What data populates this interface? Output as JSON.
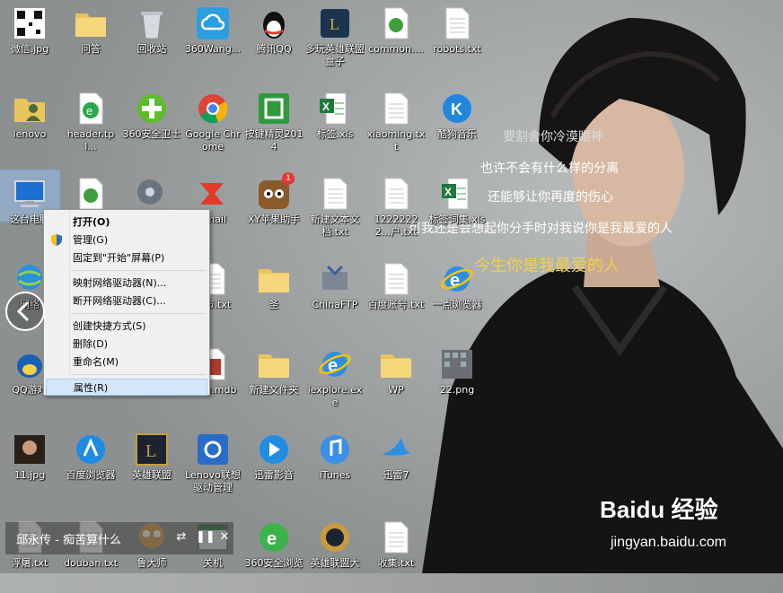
{
  "colors": {
    "accent_yellow": "#f3d04a",
    "selection": "#d5e6f8",
    "menu_bg": "#f0f0f0"
  },
  "lyrics": [
    "要割舍你冷漠眼神",
    "也许不会有什么样的分离",
    "还能够让你再度的伤心",
    "可我还是会想起你分手时对我说你是我最爱的人",
    "今生你是我最爱的人"
  ],
  "icons": [
    {
      "label": "微信.jpg",
      "icon": "qr-image-icon"
    },
    {
      "label": "问答",
      "icon": "folder-icon"
    },
    {
      "label": "回收站",
      "icon": "recycle-bin-icon"
    },
    {
      "label": "360Wang...",
      "icon": "cloud-icon"
    },
    {
      "label": "腾讯QQ",
      "icon": "qq-penguin-icon"
    },
    {
      "label": "多玩英雄联盟盒子",
      "icon": "game-box-icon"
    },
    {
      "label": "common....",
      "icon": "dreamweaver-file-icon"
    },
    {
      "label": "robots.txt",
      "icon": "text-file-icon"
    },
    {
      "label": "lenovo",
      "icon": "user-folder-icon"
    },
    {
      "label": "header.tpl...",
      "icon": "html-file-icon"
    },
    {
      "label": "360安全卫士",
      "icon": "360-guard-icon"
    },
    {
      "label": "Google Chrome",
      "icon": "chrome-icon"
    },
    {
      "label": "按键精灵2014",
      "icon": "macro-tool-icon"
    },
    {
      "label": "标签.xls",
      "icon": "excel-file-icon"
    },
    {
      "label": "xiaoming.txt",
      "icon": "text-file-icon"
    },
    {
      "label": "酷狗音乐",
      "icon": "kugou-icon"
    },
    {
      "label": "这台电脑",
      "icon": "computer-icon"
    },
    {
      "label": "",
      "icon": "dreamweaver-file-icon"
    },
    {
      "label": "",
      "icon": "settings-shield-icon"
    },
    {
      "label": "xmail",
      "icon": "foxmail-icon"
    },
    {
      "label": "XY苹果助手",
      "icon": "xy-helper-icon",
      "badge": "1"
    },
    {
      "label": "新建文本文档.txt",
      "icon": "text-file-icon"
    },
    {
      "label": "12222222...户.txt",
      "icon": "text-file-icon"
    },
    {
      "label": "标签词集.xls",
      "icon": "excel-file-icon"
    },
    {
      "label": "网络",
      "icon": "network-icon"
    },
    {
      "label": "",
      "icon": "folder-icon"
    },
    {
      "label": "省市.txt",
      "icon": "text-file-icon"
    },
    {
      "label": "圣",
      "icon": "folder-icon"
    },
    {
      "label": "ChinaFTP",
      "icon": "ftp-icon"
    },
    {
      "label": "百度账号.txt",
      "icon": "text-file-icon"
    },
    {
      "label": "一点浏览器",
      "icon": "ie-browser-icon"
    },
    {
      "label": "QQ游戏",
      "icon": "qq-game-icon"
    },
    {
      "label": "",
      "icon": "folder-icon"
    },
    {
      "label": "data.mdb",
      "icon": "database-file-icon"
    },
    {
      "label": "新建文件夹",
      "icon": "folder-icon"
    },
    {
      "label": "iexplore.exe",
      "icon": "ie-browser-icon"
    },
    {
      "label": "WP",
      "icon": "folder-icon"
    },
    {
      "label": "22.png",
      "icon": "image-file-icon"
    },
    {
      "label": "11.jpg",
      "icon": "photo-icon"
    },
    {
      "label": "百度浏览器",
      "icon": "baidu-browser-icon"
    },
    {
      "label": "英雄联盟",
      "icon": "lol-icon"
    },
    {
      "label": "Lenovo联想驱动管理",
      "icon": "lenovo-driver-icon"
    },
    {
      "label": "迅雷影音",
      "icon": "xunlei-player-icon"
    },
    {
      "label": "iTunes",
      "icon": "itunes-icon"
    },
    {
      "label": "迅雷7",
      "icon": "xunlei-bird-icon"
    },
    {
      "label": "浮屠.txt",
      "icon": "text-file-icon"
    },
    {
      "label": "douban.txt",
      "icon": "text-file-icon"
    },
    {
      "label": "鲁大师",
      "icon": "ludashi-icon"
    },
    {
      "label": "关机",
      "icon": "shutdown-icon"
    },
    {
      "label": "360安全浏览",
      "icon": "360-browser-icon"
    },
    {
      "label": "英雄联盟大",
      "icon": "lol-box-icon"
    },
    {
      "label": "收集.txt",
      "icon": "text-file-icon"
    }
  ],
  "context_menu": {
    "items": [
      {
        "label": "打开(O)",
        "bold": true
      },
      {
        "label": "管理(G)",
        "icon": "shield-icon"
      },
      {
        "label": "固定到\"开始\"屏幕(P)"
      },
      {
        "sep": true
      },
      {
        "label": "映射网络驱动器(N)..."
      },
      {
        "label": "断开网络驱动器(C)..."
      },
      {
        "sep": true
      },
      {
        "label": "创建快捷方式(S)"
      },
      {
        "label": "删除(D)"
      },
      {
        "label": "重命名(M)"
      },
      {
        "sep": true
      },
      {
        "label": "属性(R)",
        "highlighted": true
      }
    ]
  },
  "music_bar": {
    "title": "邱永传 - 痴苦算什么",
    "buttons": [
      "prev-icon",
      "pause-icon",
      "close-icon"
    ]
  },
  "watermark": {
    "logo": "Baidu 经验",
    "url": "jingyan.baidu.com"
  }
}
